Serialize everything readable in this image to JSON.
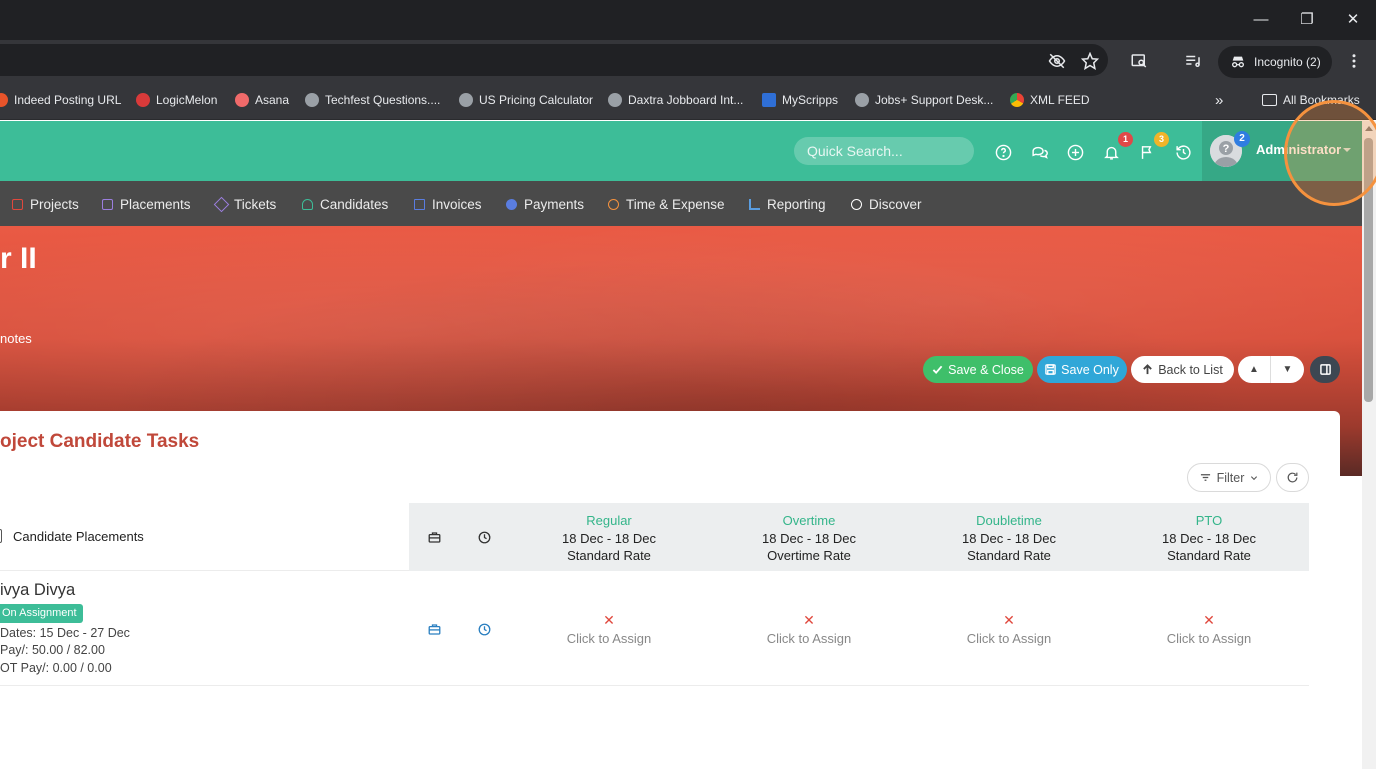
{
  "browser": {
    "incognito_label": "Incognito (2)",
    "bookmarks": [
      {
        "label": "Indeed Posting URL",
        "icon": "indeed-favicon",
        "color": "#e8542a"
      },
      {
        "label": "LogicMelon",
        "icon": "logicmelon-favicon",
        "color": "#d93a3a"
      },
      {
        "label": "Asana",
        "icon": "asana-favicon",
        "color": "#f06a6a"
      },
      {
        "label": "Techfest Questions....",
        "icon": "globe-icon",
        "color": "#9aa0a6"
      },
      {
        "label": "US Pricing Calculator",
        "icon": "globe-icon",
        "color": "#9aa0a6"
      },
      {
        "label": "Daxtra Jobboard Int...",
        "icon": "globe-icon",
        "color": "#9aa0a6"
      },
      {
        "label": "MyScripps",
        "icon": "myscripps-favicon",
        "color": "#2f6fd6"
      },
      {
        "label": "Jobs+ Support Desk...",
        "icon": "globe-icon",
        "color": "#9aa0a6"
      },
      {
        "label": "XML FEED",
        "icon": "chrome-favicon",
        "color": "#34a853"
      }
    ],
    "all_bookmarks_label": "All Bookmarks"
  },
  "header": {
    "search_placeholder": "Quick Search...",
    "notifications_count": "1",
    "flags_count": "3",
    "avatar_badge": "2",
    "user_name": "Administrator",
    "colors": {
      "bar": "#3dbd98",
      "notif_badge": "#e04848",
      "flag_badge": "#f0b429"
    }
  },
  "nav": {
    "items": [
      {
        "label": "Projects",
        "icon": "projects-icon",
        "color": "#e0483d"
      },
      {
        "label": "Placements",
        "icon": "placements-icon",
        "color": "#9b7ede"
      },
      {
        "label": "Tickets",
        "icon": "tickets-icon",
        "color": "#9b7ede"
      },
      {
        "label": "Candidates",
        "icon": "candidates-icon",
        "color": "#3dbd98"
      },
      {
        "label": "Invoices",
        "icon": "invoices-icon",
        "color": "#5a7de0"
      },
      {
        "label": "Payments",
        "icon": "payments-icon",
        "color": "#5a7de0"
      },
      {
        "label": "Time & Expense",
        "icon": "clock-icon",
        "color": "#f5923e"
      },
      {
        "label": "Reporting",
        "icon": "reporting-icon",
        "color": "#5a9de0"
      },
      {
        "label": "Discover",
        "icon": "search-icon",
        "color": "#ffffff"
      }
    ]
  },
  "hero": {
    "title_fragment": "r II",
    "notes_fragment": "notes",
    "save_close": "Save & Close",
    "save_only": "Save Only",
    "back_to_list": "Back to List"
  },
  "card": {
    "title": "oject Candidate Tasks",
    "filter_label": "Filter",
    "col_candidate": "Candidate Placements",
    "columns": [
      {
        "name": "Regular",
        "dates": "18 Dec - 18 Dec",
        "rate": "Standard Rate"
      },
      {
        "name": "Overtime",
        "dates": "18 Dec - 18 Dec",
        "rate": "Overtime Rate"
      },
      {
        "name": "Doubletime",
        "dates": "18 Dec - 18 Dec",
        "rate": "Standard Rate"
      },
      {
        "name": "PTO",
        "dates": "18 Dec - 18 Dec",
        "rate": "Standard Rate"
      }
    ],
    "row": {
      "name": "ivya Divya",
      "status": "On Assignment",
      "dates": "Dates: 15 Dec - 27 Dec",
      "pay": "Pay/: 50.00 / 82.00",
      "ot_pay": "OT Pay/: 0.00 / 0.00",
      "assign_label": "Click to Assign"
    }
  }
}
